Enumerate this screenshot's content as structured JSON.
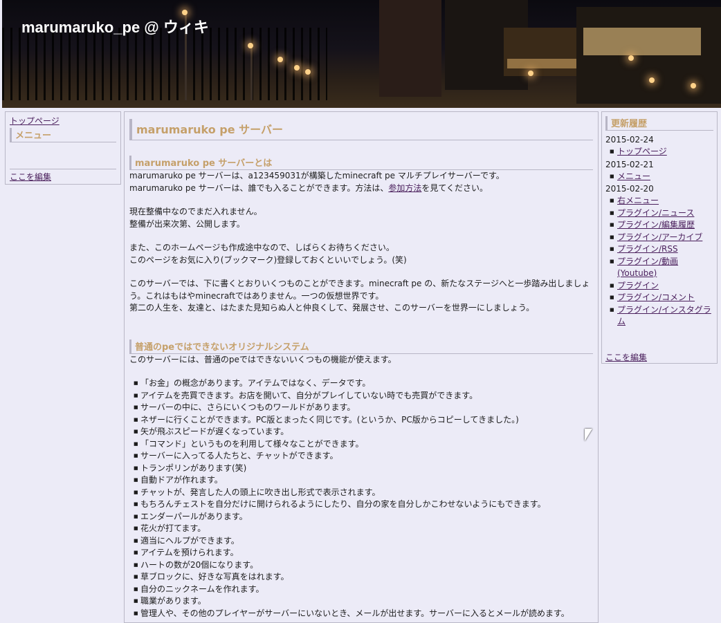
{
  "site_title": "marumaruko_pe @ ウィキ",
  "left_menu": {
    "top_link": "トップページ",
    "menu_heading": "メニュー",
    "edit_link": "ここを編集"
  },
  "main": {
    "page_title": "marumaruko pe サーバー",
    "section1": {
      "heading": "marumaruko pe サーバーとは",
      "line1": "marumaruko pe サーバーは、a123459031が構築したminecraft pe マルチプレイサーバーです。",
      "line2_before": "marumaruko pe サーバーは、誰でも入ることができます。方法は、",
      "line2_link": "参加方法",
      "line2_after": "を見てください。",
      "line3": "現在整備中なのでまだ入れません。",
      "line4": "整備が出来次第、公開します。",
      "line5": "また、このホームページも作成途中なので、しばらくお待ちください。",
      "line6": "このページをお気に入り(ブックマーク)登録しておくといいでしょう。(笑)",
      "line7": "このサーバーでは、下に書くとおりいくつものことができます。minecraft pe の、新たなステージへと一歩踏み出しましょう。これはもはやminecraftではありません。一つの仮想世界です。",
      "line8": "第二の人生を、友達と、はたまた見知らぬ人と仲良くして、発展させ、このサーバーを世界一にしましょう。"
    },
    "section2": {
      "heading": "普通のpeではできないオリジナルシステム",
      "intro": "このサーバーには、普通のpeではできないいくつもの機能が使えます。",
      "features": [
        "「お金」の概念があります。アイテムではなく、データです。",
        "アイテムを売買できます。お店を開いて、自分がプレイしていない時でも売買ができます。",
        "サーバーの中に、さらにいくつものワールドがあります。",
        "ネザーに行くことができます。PC版とまったく同じです。(というか、PC版からコピーしてきました。)",
        "矢が飛ぶスピードが遅くなっています。",
        "「コマンド」というものを利用して様々なことができます。",
        "サーバーに入ってる人たちと、チャットができます。",
        "トランポリンがあります(笑)",
        "自動ドアが作れます。",
        "チャットが、発言した人の頭上に吹き出し形式で表示されます。",
        "もちろんチェストを自分だけに開けられるようにしたり、自分の家を自分しかこわせないようにもできます。",
        "エンダーパールがあります。",
        "花火が打てます。",
        "適当にヘルプができます。",
        "アイテムを預けられます。",
        "ハートの数が20個になります。",
        "草ブロックに、好きな写真をはれます。",
        "自分のニックネームを作れます。",
        "職業があります。",
        "管理人や、その他のプレイヤーがサーバーにいないとき、メールが出せます。サーバーに入るとメールが読めます。"
      ]
    }
  },
  "right_menu": {
    "heading": "更新履歴",
    "groups": [
      {
        "date": "2015-02-24",
        "items": [
          "トップページ"
        ]
      },
      {
        "date": "2015-02-21",
        "items": [
          "メニュー"
        ]
      },
      {
        "date": "2015-02-20",
        "items": [
          "右メニュー",
          "プラグイン/ニュース",
          "プラグイン/編集履歴",
          "プラグイン/アーカイブ",
          "プラグイン/RSS",
          "プラグイン/動画(Youtube)",
          "プラグイン",
          "プラグイン/コメント",
          "プラグイン/インスタグラム"
        ]
      }
    ],
    "edit_link": "ここを編集"
  },
  "icons": {
    "cursor": "mouse-pointer-icon"
  }
}
